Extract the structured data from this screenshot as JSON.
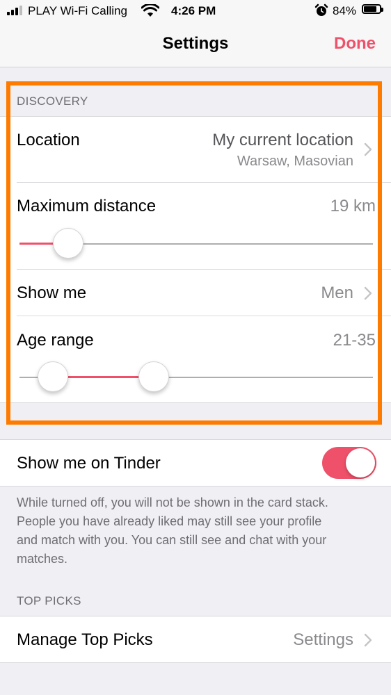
{
  "status_bar": {
    "carrier": "PLAY Wi-Fi Calling",
    "time": "4:26 PM",
    "battery_percent": "84%",
    "battery_level": 0.84
  },
  "nav": {
    "title": "Settings",
    "done_label": "Done"
  },
  "discovery": {
    "header": "DISCOVERY",
    "location": {
      "label": "Location",
      "value": "My current location",
      "sub": "Warsaw, Masovian"
    },
    "max_distance": {
      "label": "Maximum distance",
      "value": "19 km"
    },
    "show_me": {
      "label": "Show me",
      "value": "Men"
    },
    "age_range": {
      "label": "Age range",
      "value": "21-35"
    }
  },
  "show_on_tinder": {
    "label": "Show me on Tinder",
    "enabled": true,
    "footnote_lines": [
      "While turned off, you will not be shown in the card stack.",
      "People you have already liked may still see your profile",
      "and match with you. You can still see and chat with your",
      "matches."
    ]
  },
  "top_picks": {
    "header": "TOP PICKS",
    "label": "Manage Top Picks",
    "value": "Settings"
  },
  "colors": {
    "accent": "#ee5169",
    "highlight": "#ff7b00",
    "background": "#efeff4",
    "secondary_text": "#8a8a8e"
  }
}
